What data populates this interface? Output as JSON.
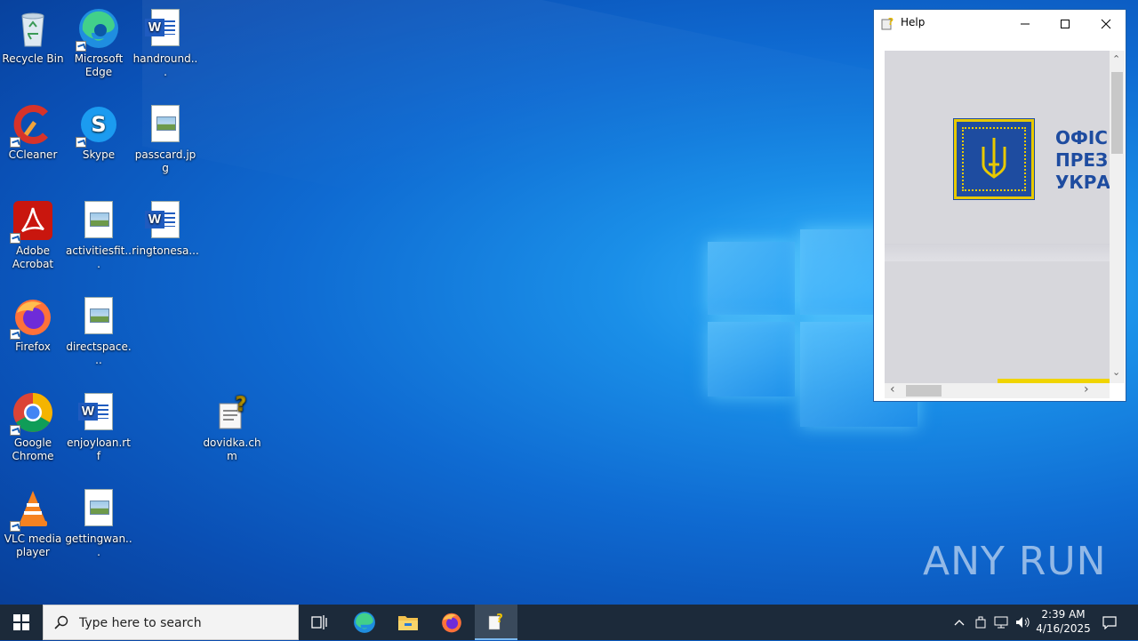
{
  "desktop": {
    "icons": [
      {
        "label": "Recycle Bin",
        "icon": "recycle-bin-icon"
      },
      {
        "label": "Microsoft Edge",
        "icon": "edge-icon"
      },
      {
        "label": "handround...",
        "icon": "word-doc-icon"
      },
      {
        "label": "CCleaner",
        "icon": "ccleaner-icon"
      },
      {
        "label": "Skype",
        "icon": "skype-icon"
      },
      {
        "label": "passcard.jpg",
        "icon": "image-file-icon"
      },
      {
        "label": "Adobe Acrobat",
        "icon": "acrobat-icon"
      },
      {
        "label": "activitiesfit...",
        "icon": "image-file-icon"
      },
      {
        "label": "ringtonesa...",
        "icon": "word-doc-icon"
      },
      {
        "label": "Firefox",
        "icon": "firefox-icon"
      },
      {
        "label": "directspace...",
        "icon": "image-file-icon"
      },
      {
        "label": "Google Chrome",
        "icon": "chrome-icon"
      },
      {
        "label": "enjoyloan.rtf",
        "icon": "word-doc-icon"
      },
      {
        "label": "dovidka.chm",
        "icon": "chm-help-icon"
      },
      {
        "label": "VLC media player",
        "icon": "vlc-icon"
      },
      {
        "label": "gettingwan...",
        "icon": "image-file-icon"
      }
    ]
  },
  "help_window": {
    "title": "Help",
    "content_text": {
      "line1": "ОФІС",
      "line2": "ПРЕЗ",
      "line3": "УКРА"
    }
  },
  "watermark": {
    "text": "ANY RUN"
  },
  "taskbar": {
    "search_placeholder": "Type here to search",
    "clock_time": "2:39 AM",
    "clock_date": "4/16/2025"
  },
  "colors": {
    "accent": "#0f6bd2",
    "taskbar": "#1c2a3a",
    "emblem_blue": "#1e4ca0",
    "emblem_gold": "#e8c900"
  }
}
